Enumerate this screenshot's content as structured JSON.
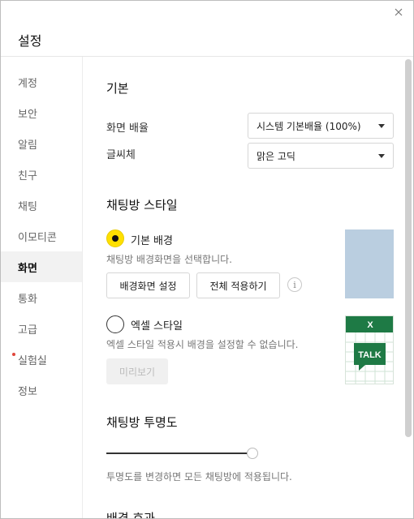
{
  "header": {
    "title": "설정",
    "close_icon": "close-icon"
  },
  "sidebar": {
    "items": [
      {
        "label": "계정"
      },
      {
        "label": "보안"
      },
      {
        "label": "알림"
      },
      {
        "label": "친구"
      },
      {
        "label": "채팅"
      },
      {
        "label": "이모티콘"
      },
      {
        "label": "화면",
        "active": true
      },
      {
        "label": "통화"
      },
      {
        "label": "고급"
      },
      {
        "label": "실험실",
        "badge": "new-dot"
      },
      {
        "label": "정보"
      }
    ]
  },
  "basic": {
    "title": "기본",
    "zoom_label": "화면 배율",
    "zoom_value": "시스템 기본배율 (100%)",
    "font_label": "글씨체",
    "font_value": "맑은 고딕"
  },
  "chat_style": {
    "title": "채팅방 스타일",
    "basic_option": {
      "label": "기본 배경",
      "selected": true,
      "desc": "채팅방 배경화면을 선택합니다.",
      "set_bg_button": "배경화면 설정",
      "apply_all_button": "전체 적용하기",
      "info_icon": "i",
      "preview_color": "#bacee0"
    },
    "excel_option": {
      "label": "엑셀 스타일",
      "selected": false,
      "desc": "엑셀 스타일 적용시 배경을 설정할 수 없습니다.",
      "preview_button": "미리보기",
      "preview_x": "X",
      "preview_talk": "TALK"
    }
  },
  "transparency": {
    "title": "채팅방 투명도",
    "value_percent": 100,
    "desc": "투명도를 변경하면 모든 채팅방에 적용됩니다."
  },
  "bg_effect": {
    "title": "배경 효과"
  },
  "colors": {
    "accent_yellow": "#ffe000",
    "excel_green": "#1e7a45",
    "preview_blue": "#bacee0"
  }
}
